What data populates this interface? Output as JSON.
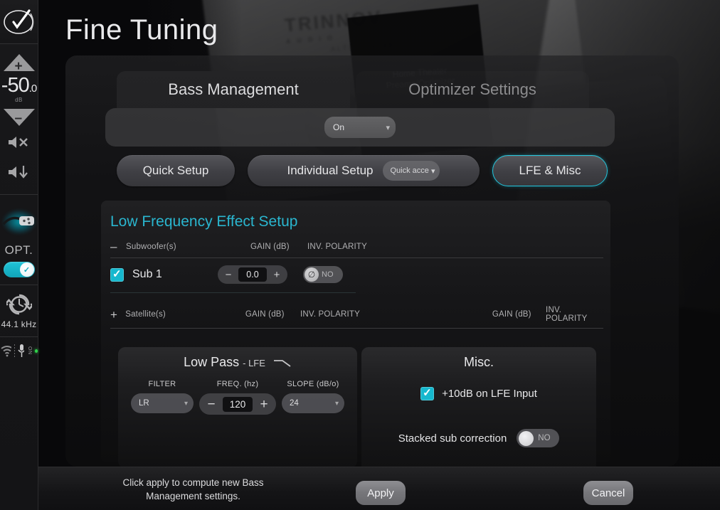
{
  "sidebar": {
    "logo_icon": "trinnov-check-logo-icon",
    "volume": {
      "up_icon": "volume-up-triangle-icon",
      "down_icon": "volume-down-triangle-icon",
      "value": "-50",
      "decimal": ".0",
      "unit": "dB"
    },
    "mute_icon": "speaker-mute-icon",
    "dim_icon": "speaker-dim-icon",
    "optimizer": {
      "connector_icon": "xlr-connector-icon",
      "label": "OPT.",
      "toggle_state": "on",
      "toggle_icon": "check-icon"
    },
    "sample_rate": {
      "icon": "clock-sync-icon",
      "value": "44.1 kHz"
    },
    "status": {
      "wifi_icon": "wifi-icon",
      "mic_icon": "microphone-icon",
      "mic_label": "ON",
      "indicator_color": "#2fd24a"
    }
  },
  "header": {
    "title": "Fine Tuning"
  },
  "background": {
    "brand": "TRINNOV",
    "brand_sub": "AUDIO",
    "model": "ALTITUDE 48",
    "screen_text": "Home Theater Preamp/Optimizer"
  },
  "tabs": [
    {
      "label": "Bass Management",
      "active": true
    },
    {
      "label": "Optimizer Settings",
      "active": false
    }
  ],
  "sub_bar": {
    "dropdown_value": "On",
    "chevron_icon": "chevron-down-icon"
  },
  "mode_row": {
    "quick_setup": "Quick Setup",
    "individual_setup": "Individual Setup",
    "quick_access_value": "Quick acce",
    "quick_access_chevron": "chevron-down-icon",
    "lfe_misc": "LFE & Misc",
    "accent_color": "#22c6dd"
  },
  "card": {
    "title": "Low Frequency Effect Setup",
    "title_color": "#2ab6cf",
    "subwoofer_section": {
      "expander_icon": "minus-collapse-icon",
      "headers": [
        "Subwoofer(s)",
        "GAIN (dB)",
        "INV. POLARITY"
      ],
      "rows": [
        {
          "enabled": true,
          "name": "Sub 1",
          "gain": "0.0",
          "minus": "−",
          "plus": "+",
          "polarity_label": "NO",
          "polarity_icon": "phase-invert-icon"
        }
      ]
    },
    "satellite_section": {
      "expander_icon": "plus-expand-icon",
      "headers": [
        "Satellite(s)",
        "GAIN (dB)",
        "INV. POLARITY",
        "GAIN (dB)",
        "INV. POLARITY"
      ]
    }
  },
  "low_pass": {
    "title": "Low Pass",
    "title_sub": "- LFE",
    "curve_icon": "low-pass-curve-icon",
    "filter_label": "FILTER",
    "filter_value": "LR",
    "freq_label": "FREQ. (hz)",
    "freq_value": "120",
    "freq_minus": "−",
    "freq_plus": "+",
    "slope_label": "SLOPE (dB/o)",
    "slope_value": "24",
    "chevron_icon": "chevron-down-icon"
  },
  "misc": {
    "title": "Misc.",
    "lfe_boost_label": "+10dB on LFE Input",
    "lfe_boost_checked": true,
    "stacked_label": "Stacked sub correction",
    "stacked_value": "NO"
  },
  "footer": {
    "hint_line1": "Click apply to compute new Bass",
    "hint_line2": "Management settings.",
    "apply_label": "Apply",
    "cancel_label": "Cancel"
  }
}
